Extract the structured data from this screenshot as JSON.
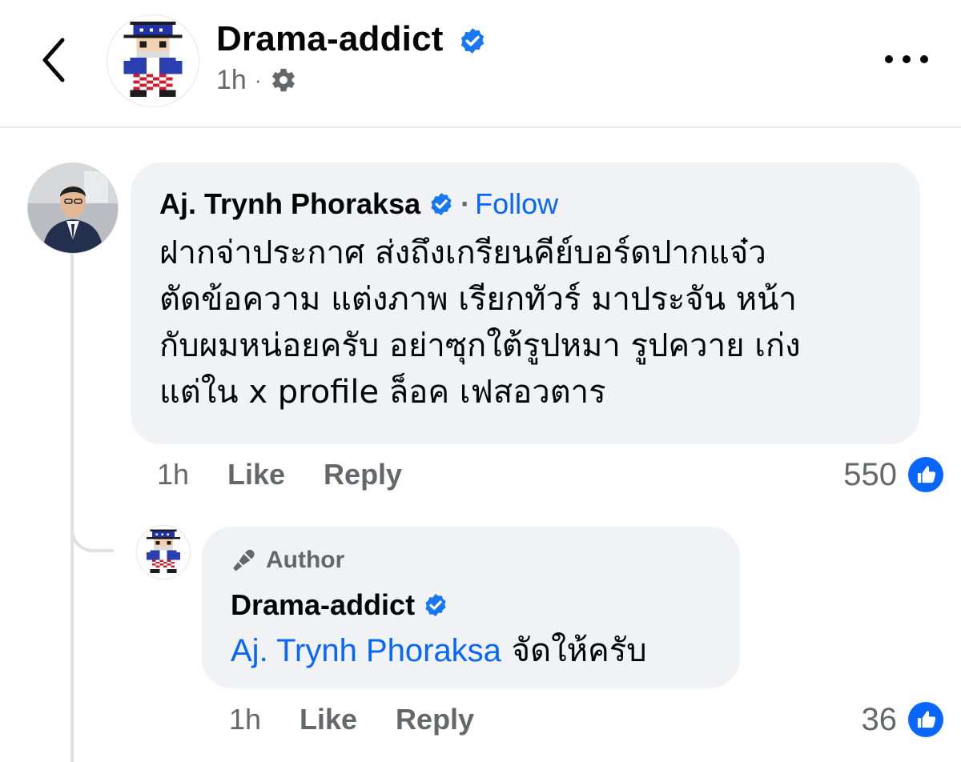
{
  "header": {
    "page_name": "Drama-addict",
    "time": "1h",
    "separator": "·"
  },
  "comment": {
    "author": "Aj. Trynh Phoraksa",
    "follow_separator": "·",
    "follow_label": "Follow",
    "text": "ฝากจ่าประกาศ ส่งถึงเกรียนคีย์บอร์ดปากแจ๋ว\nตัดข้อความ แต่งภาพ เรียกทัวร์ มาประจัน หน้า\nกับผมหน่อยครับ อย่าซุกใต้รูปหมา รูปควาย เก่ง\nแต่ใน x profile ล็อค เฟสอวตาร",
    "time": "1h",
    "like_label": "Like",
    "reply_label": "Reply",
    "reaction_count": "550"
  },
  "reply": {
    "badge_label": "Author",
    "author": "Drama-addict",
    "mention": "Aj. Trynh Phoraksa",
    "text": " จัดให้ครับ",
    "time": "1h",
    "like_label": "Like",
    "reply_label": "Reply",
    "reaction_count": "36"
  },
  "colors": {
    "accent_blue": "#0866ff",
    "bubble_bg": "#f0f2f5",
    "secondary_text": "#65676b",
    "verified_blue": "#1877f2"
  },
  "icons": {
    "back": "chevron-left-icon",
    "verified": "verified-badge-icon",
    "audience": "gear-icon",
    "more": "more-horizontal-icon",
    "like_reaction": "thumbs-up-icon",
    "author": "microphone-icon"
  }
}
